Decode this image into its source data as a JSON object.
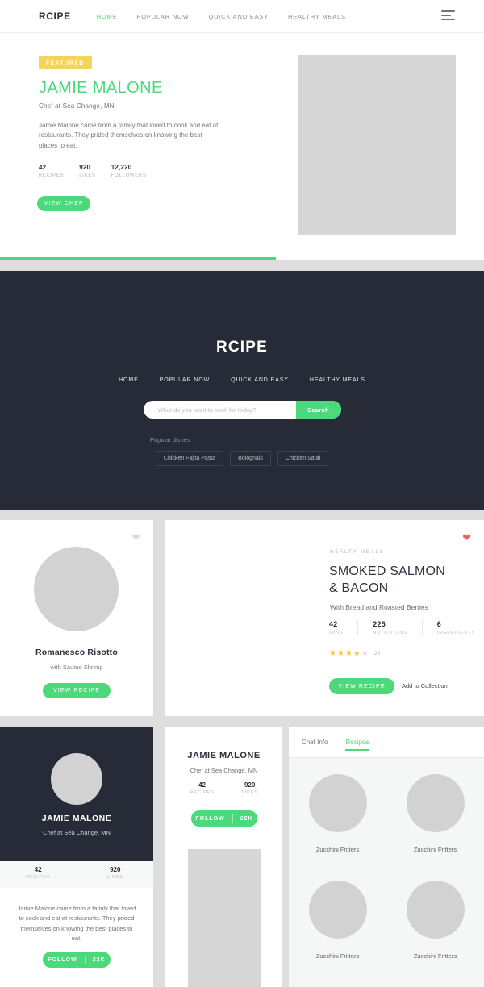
{
  "topnav": {
    "brand": "RCIPE",
    "links": [
      {
        "label": "HOME",
        "active": true
      },
      {
        "label": "POPULAR NOW",
        "active": false
      },
      {
        "label": "QUICK AND EASY",
        "active": false
      },
      {
        "label": "HEALTHY MEALS",
        "active": false
      }
    ],
    "menu_icon": "hamburger-icon"
  },
  "hero": {
    "badge": "FEATURED",
    "title": "JAMIE MALONE",
    "subtitle": "Chef at Sea Change, MN",
    "bio": "Jamie Malone came from a family that loved to cook and eat at restaurants. They prided themselves on knowing the best places to eat.",
    "stats": [
      {
        "num": "42",
        "label": "RECIPES"
      },
      {
        "num": "920",
        "label": "LIKES"
      },
      {
        "num": "12,220",
        "label": "FOLLOWERS"
      }
    ],
    "cta": "VIEW CHEF",
    "carousel_dots": 4,
    "carousel_active_index": 0
  },
  "progress": {
    "percent": 57
  },
  "search_section": {
    "brand": "RCIPE",
    "nav": [
      "HOME",
      "POPULAR NOW",
      "QUICK AND EASY",
      "HEALTHY MEALS"
    ],
    "search_placeholder": "What do you want to cook for today?",
    "search_value": "",
    "search_button": "Search",
    "popular_label": "Popular dishes",
    "tags": [
      "Chicken Fajita Pasta",
      "Bolognais",
      "Chicken Satai"
    ]
  },
  "risotto_card": {
    "favorite_icon": "heart-icon-outline",
    "title": "Romanesco Risotto",
    "subtitle": "with Sauted Shrimp",
    "cta": "VIEW RECIPE"
  },
  "salmon_card": {
    "favorite_icon": "heart-icon-filled",
    "category": "HEALTY MEALS",
    "title_line1": "SMOKED SALMON",
    "title_line2": "& BACON",
    "subtitle": "With Bread and Roasted Berries",
    "stats": [
      {
        "num": "42",
        "label": "MINS"
      },
      {
        "num": "225",
        "label": "NUTRITIONS"
      },
      {
        "num": "6",
        "label": "INGREDIENTS"
      }
    ],
    "rating": 4,
    "rating_max": 5,
    "rating_count": "29",
    "cta": "VIEW RECIPE",
    "secondary_cta": "Add to Collection"
  },
  "chef_dark_card": {
    "name": "JAMIE MALONE",
    "subtitle": "Chef at Sea Change, MN",
    "stats": [
      {
        "num": "42",
        "label": "RECIPES"
      },
      {
        "num": "920",
        "label": "LIKES"
      }
    ],
    "bio": "Jamie Malone came from a family that loved to cook and eat at restaurants. They prided themselves on knowing the best places to eat.",
    "follow_label": "FOLLOW",
    "follow_count": "22K"
  },
  "profile_card": {
    "name": "JAMIE MALONE",
    "subtitle": "Chef at Sea Change, MN",
    "stats": [
      {
        "num": "42",
        "label": "RECIPES"
      },
      {
        "num": "920",
        "label": "LIKES"
      }
    ],
    "follow_label": "FOLLOW",
    "follow_count": "22K"
  },
  "tabs_panel": {
    "tabs": [
      {
        "label": "Chef Info",
        "active": false
      },
      {
        "label": "Recipes",
        "active": true
      }
    ],
    "recipes": [
      {
        "label": "Zucchini Fritters"
      },
      {
        "label": "Zucchini Fritters"
      },
      {
        "label": "Zucchini Fritters"
      },
      {
        "label": "Zucchini Fritters"
      }
    ]
  },
  "colors": {
    "accent_green": "#4cd97b",
    "dark": "#272b38",
    "badge_yellow": "#f5d45c",
    "heart_red": "#f85f5f",
    "star_gold": "#f5c14b",
    "placeholder_grey": "#d6d6d6",
    "page_bg": "#dededf"
  }
}
